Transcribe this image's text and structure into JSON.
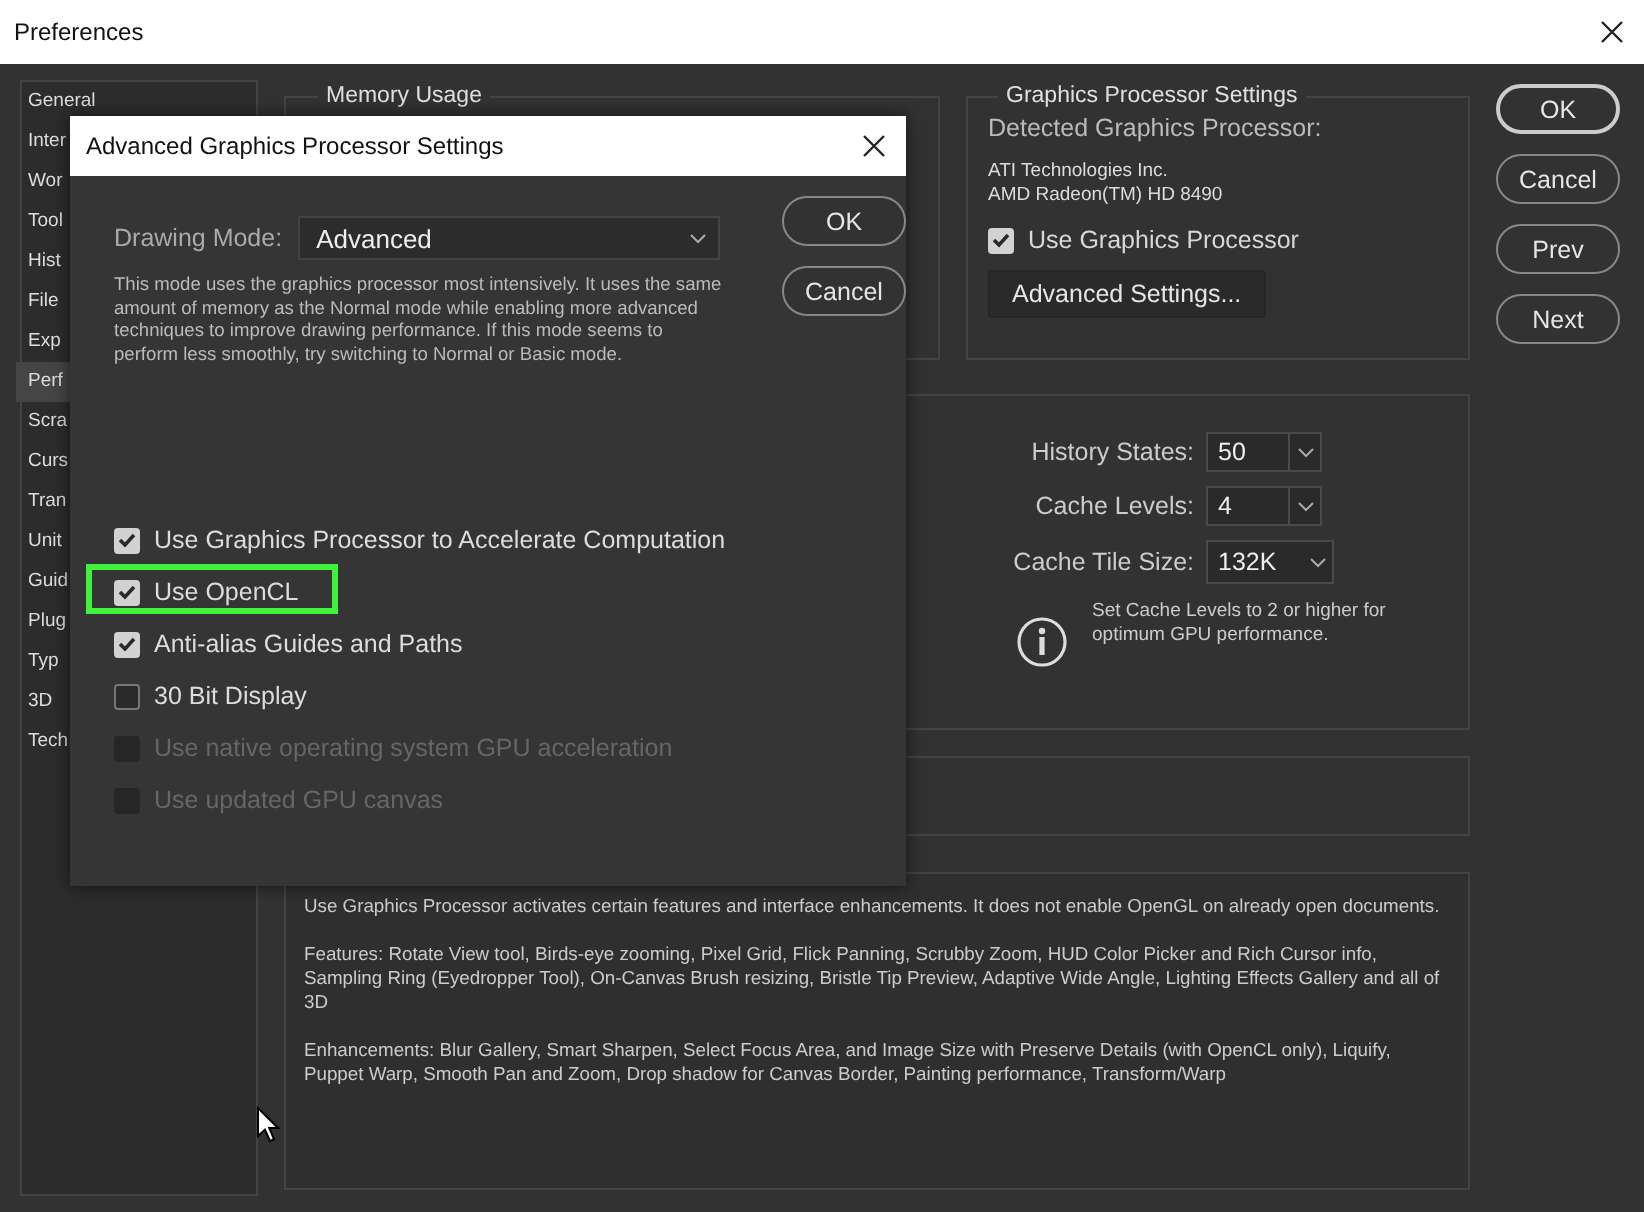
{
  "window": {
    "title": "Preferences"
  },
  "sidebar": {
    "items": [
      {
        "label": "General",
        "selected": false
      },
      {
        "label": "Inter",
        "selected": false
      },
      {
        "label": "Wor",
        "selected": false
      },
      {
        "label": "Tool",
        "selected": false
      },
      {
        "label": "Hist",
        "selected": false
      },
      {
        "label": "File",
        "selected": false
      },
      {
        "label": "Exp",
        "selected": false
      },
      {
        "label": "Perf",
        "selected": true
      },
      {
        "label": "Scra",
        "selected": false
      },
      {
        "label": "Curs",
        "selected": false
      },
      {
        "label": "Tran",
        "selected": false
      },
      {
        "label": "Unit",
        "selected": false
      },
      {
        "label": "Guid",
        "selected": false
      },
      {
        "label": "Plug",
        "selected": false
      },
      {
        "label": "Typ",
        "selected": false
      },
      {
        "label": "3D",
        "selected": false
      },
      {
        "label": "Tech",
        "selected": false
      }
    ]
  },
  "memory_panel": {
    "title": "Memory Usage"
  },
  "gpu_panel": {
    "title": "Graphics Processor Settings",
    "detected_label": "Detected Graphics Processor:",
    "vendor": "ATI Technologies Inc.",
    "model": "AMD Radeon(TM) HD 8490",
    "use_gpu": {
      "label": "Use Graphics Processor",
      "checked": true
    },
    "advanced_button": "Advanced Settings..."
  },
  "history_panel": {
    "fields": [
      {
        "label": "History States:",
        "value": "50"
      },
      {
        "label": "Cache Levels:",
        "value": "4"
      },
      {
        "label": "Cache Tile Size:",
        "value": "132K"
      }
    ],
    "note": "Set Cache Levels to 2 or higher for optimum GPU performance."
  },
  "description": [
    "Use Graphics Processor activates certain features and interface enhancements. It does not enable OpenGL on already open documents.",
    "Features: Rotate View tool, Birds-eye zooming, Pixel Grid, Flick Panning, Scrubby Zoom, HUD Color Picker and Rich Cursor info, Sampling Ring (Eyedropper Tool), On-Canvas Brush resizing, Bristle Tip Preview, Adaptive Wide Angle, Lighting Effects Gallery and all of 3D",
    "Enhancements: Blur Gallery, Smart Sharpen, Select Focus Area, and Image Size with Preserve Details (with OpenCL only), Liquify, Puppet Warp, Smooth Pan and Zoom, Drop shadow for Canvas Border, Painting performance, Transform/Warp"
  ],
  "buttons": [
    "OK",
    "Cancel",
    "Prev",
    "Next"
  ],
  "dialog": {
    "title": "Advanced Graphics Processor Settings",
    "mode_label": "Drawing Mode:",
    "mode_value": "Advanced",
    "mode_description": "This mode uses the graphics processor most intensively.  It uses the same amount of memory as the Normal mode while enabling more advanced techniques to improve drawing performance.  If this mode seems to perform less smoothly, try switching to Normal or Basic mode.",
    "buttons": [
      "OK",
      "Cancel"
    ],
    "options": [
      {
        "label": "Use Graphics Processor to Accelerate Computation",
        "checked": true,
        "disabled": false,
        "highlighted": false
      },
      {
        "label": "Use OpenCL",
        "checked": true,
        "disabled": false,
        "highlighted": true
      },
      {
        "label": "Anti-alias Guides and Paths",
        "checked": true,
        "disabled": false,
        "highlighted": false
      },
      {
        "label": "30 Bit Display",
        "checked": false,
        "disabled": false,
        "highlighted": false
      },
      {
        "label": "Use native operating system GPU acceleration",
        "checked": false,
        "disabled": true,
        "highlighted": false
      },
      {
        "label": "Use updated GPU canvas",
        "checked": false,
        "disabled": true,
        "highlighted": false
      }
    ]
  }
}
